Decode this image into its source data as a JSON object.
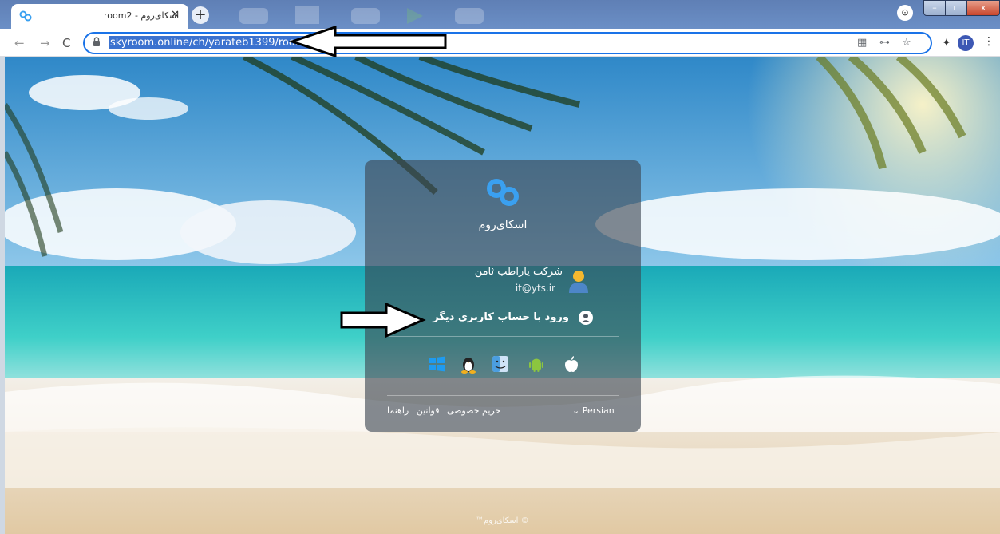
{
  "browser": {
    "tab_title": "room2 - اسکای‌روم",
    "tab_close": "✕",
    "new_tab": "+",
    "url": "skyroom.online/ch/yarateb1399/room2",
    "avatar_initials": "IT",
    "profile_badge": "⊙",
    "menu_icon": "⋮",
    "nav": {
      "back": "←",
      "forward": "→",
      "reload": "C"
    },
    "omni_icons": {
      "cast": "▦",
      "key": "⊶",
      "star": "☆",
      "extensions": "✦"
    },
    "window_controls": {
      "min": "–",
      "max": "▫",
      "close": "x"
    }
  },
  "login_card": {
    "brand": "اسکای‌روم",
    "user_name": "شرکت یاراطب ثامن",
    "user_email": "it@yts.ir",
    "other_account": "ورود با حساب کاربری دیگر",
    "platforms": [
      "windows-icon",
      "linux-icon",
      "mac-icon",
      "android-icon",
      "apple-icon"
    ],
    "language": "Persian",
    "language_caret": "⌄",
    "footer_links": [
      "حریم خصوصی",
      "قوانین",
      "راهنما"
    ]
  },
  "copyright": "™اسکای‌روم ©",
  "colors": {
    "accent": "#1a73e8",
    "url_highlight": "#3b72cf",
    "card_bg": "rgba(60,70,80,.62)",
    "logo": "#3aa0f0"
  }
}
